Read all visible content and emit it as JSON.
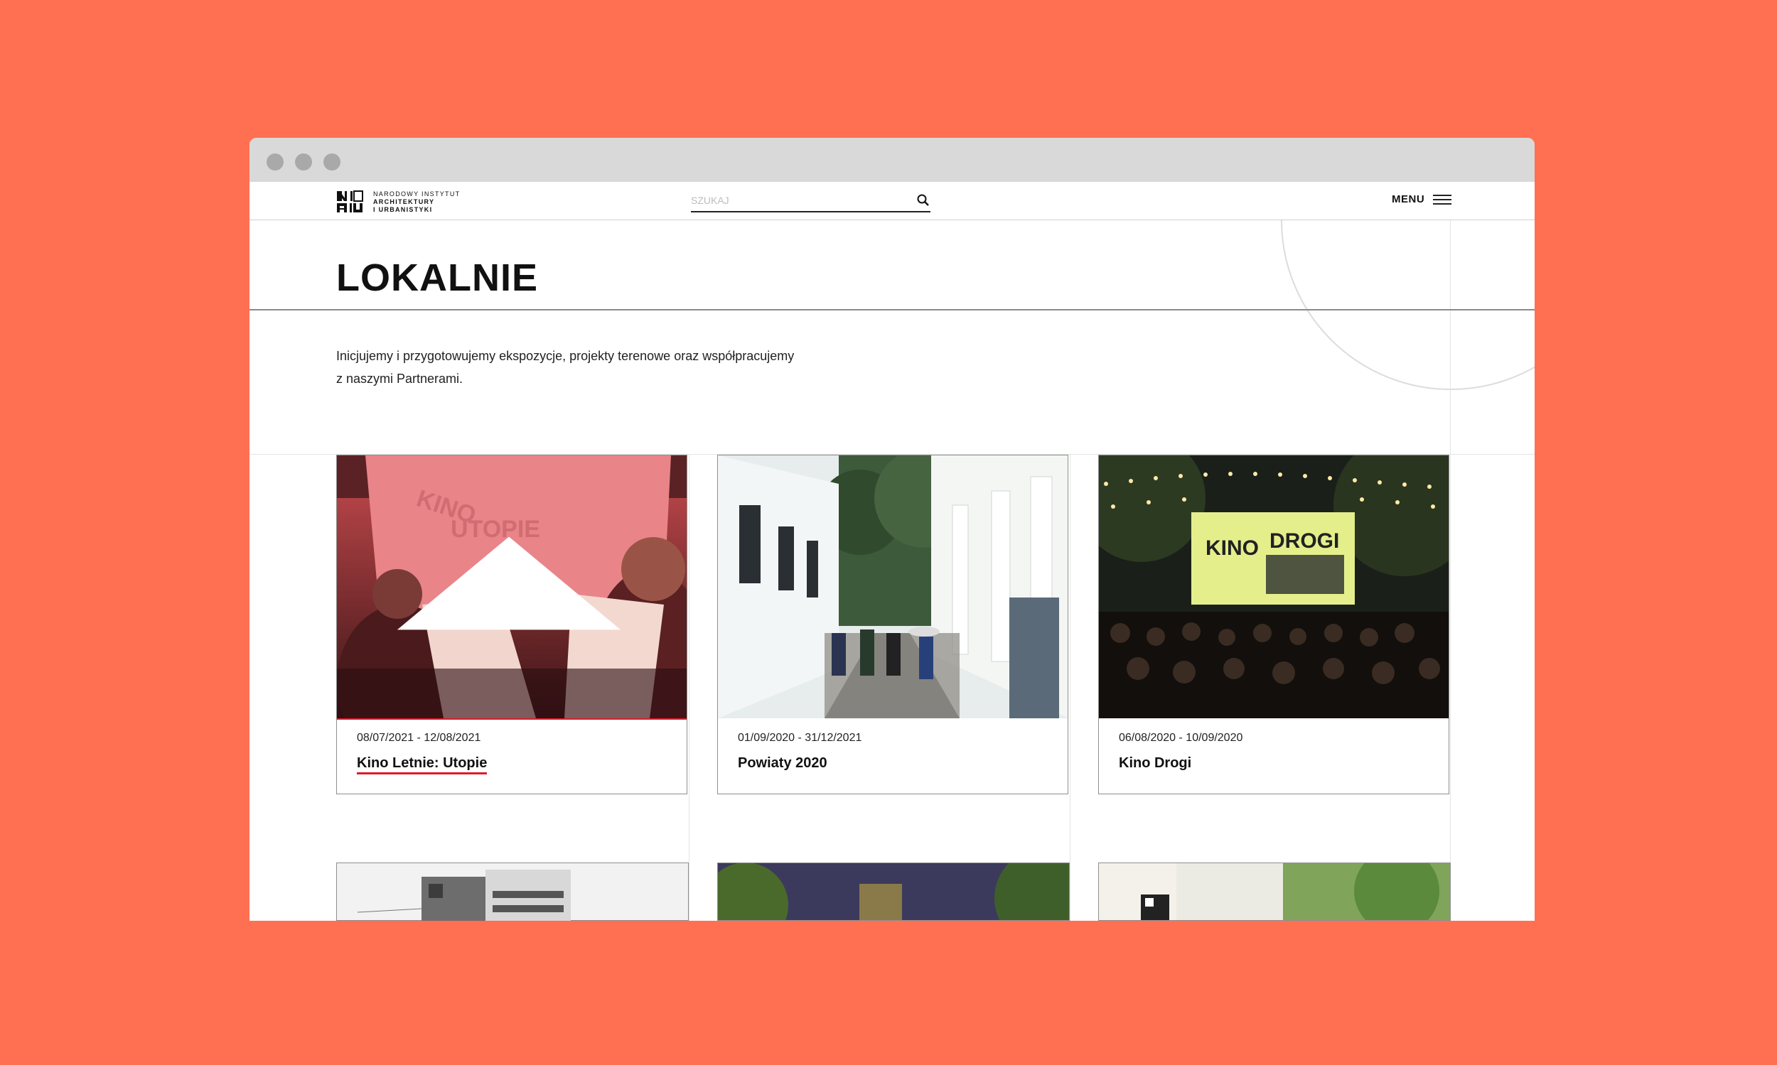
{
  "header": {
    "logo_line1": "NARODOWY INSTYTUT",
    "logo_line2": "ARCHITEKTURY",
    "logo_line3": "I URBANISTYKI",
    "search_placeholder": "SZUKAJ",
    "menu_label": "MENU"
  },
  "page": {
    "title": "LOKALNIE",
    "intro_line1": "Inicjujemy i przygotowujemy ekspozycje, projekty terenowe oraz współpracujemy",
    "intro_line2": "z naszymi Partnerami."
  },
  "cards": [
    {
      "date": "08/07/2021 - 12/08/2021",
      "title": "Kino Letnie: Utopie"
    },
    {
      "date": "01/09/2020 - 31/12/2021",
      "title": "Powiaty 2020"
    },
    {
      "date": "06/08/2020 - 10/09/2020",
      "title": "Kino Drogi"
    }
  ],
  "card_images": {
    "card1_screen_text1": "KINO",
    "card1_screen_text2": "UTOPIE",
    "card3_poster_text1": "KINO",
    "card3_poster_text2": "DROGI"
  },
  "colors": {
    "background": "#ff7052",
    "accent_red": "#e01a2a",
    "chrome": "#d9d9d9"
  },
  "icons": [
    "search-icon",
    "hamburger-menu-icon",
    "play-triangle-icon",
    "mouse-cursor-icon"
  ]
}
